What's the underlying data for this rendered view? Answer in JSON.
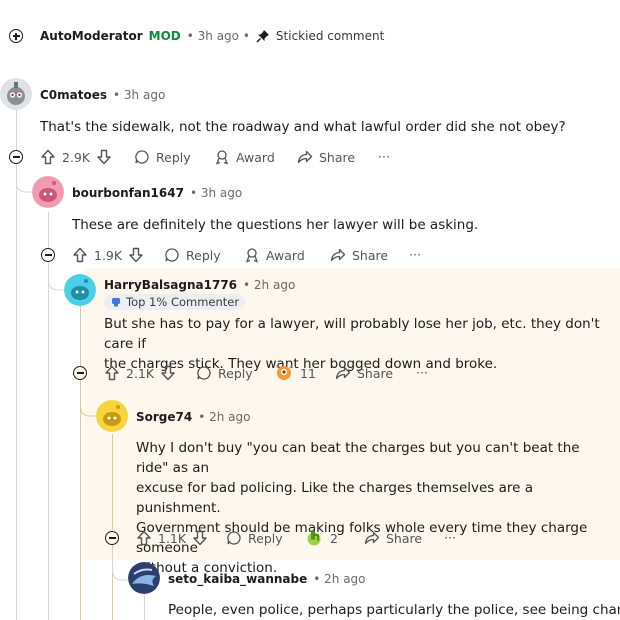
{
  "header": {
    "author": "AutoModerator",
    "mod_badge": "MOD",
    "time": "• 3h ago •",
    "stickied": "Stickied comment"
  },
  "comments": [
    {
      "author": "C0matoes",
      "time": "• 3h ago",
      "body": "That's the sidewalk, not the roadway and what lawful order did she not obey?",
      "votes": "2.9K",
      "reply": "Reply",
      "award": "Award",
      "share": "Share",
      "more": "···"
    },
    {
      "author": "bourbonfan1647",
      "time": "• 3h ago",
      "body": "These are definitely the questions her lawyer will be asking.",
      "votes": "1.9K",
      "reply": "Reply",
      "award": "Award",
      "share": "Share",
      "more": "···"
    },
    {
      "author": "HarryBalsagna1776",
      "time": "• 2h ago",
      "flair": "Top 1% Commenter",
      "body_lines": [
        "But she has to pay for a lawyer, will probably lose her job, etc.  they don't care if",
        "the charges stick.  They want her bogged down and broke."
      ],
      "votes": "2.1K",
      "reply": "Reply",
      "award_count": "11",
      "share": "Share",
      "more": "···"
    },
    {
      "author": "Sorge74",
      "time": "• 2h ago",
      "body_lines": [
        "Why I don't buy \"you can beat the charges but you can't beat the ride\" as an",
        "excuse for bad policing. Like the charges themselves are a punishment.",
        "Government should be making folks whole every time they charge someone",
        "without a conviction."
      ],
      "votes": "1.1K",
      "reply": "Reply",
      "award_count": "2",
      "share": "Share",
      "more": "···"
    },
    {
      "author": "seto_kaiba_wannabe",
      "time": "• 2h ago",
      "body": "People, even police, perhaps particularly the police, see being charged"
    }
  ],
  "colors": {
    "mod_green": "#0a8a3a",
    "highlight_bg": "#fdf7ee",
    "thread_line": "#d4d6d8",
    "award_orange": "#f49b2b",
    "award_green": "#79c51f"
  }
}
